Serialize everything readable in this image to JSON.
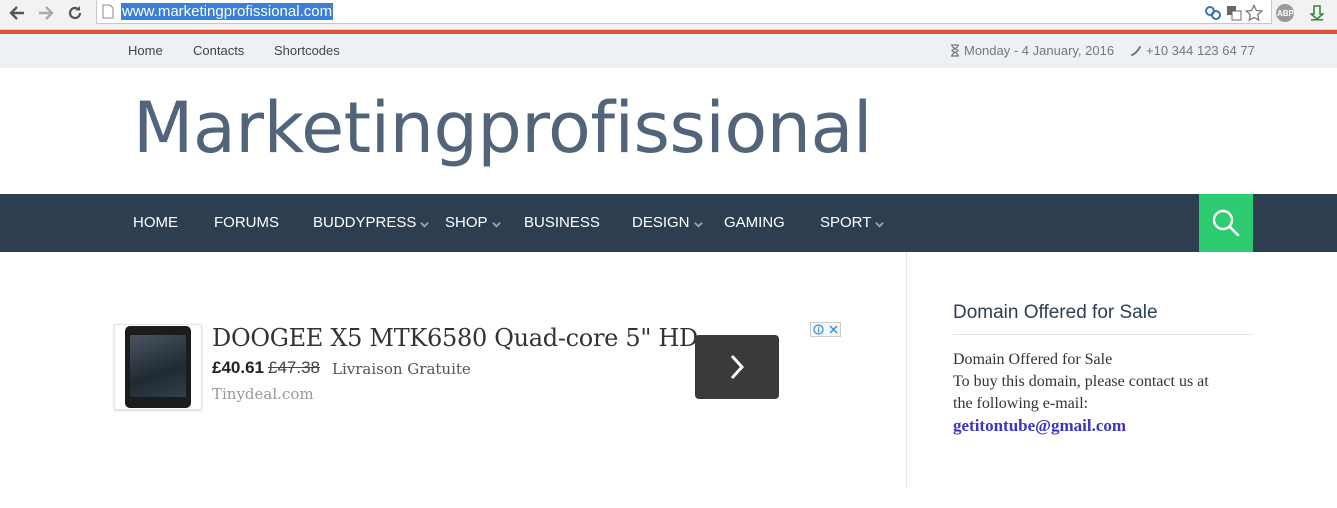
{
  "browser": {
    "url": "www.marketingprofissional.com",
    "abp_label": "ABP"
  },
  "topbar": {
    "links": [
      "Home",
      "Contacts",
      "Shortcodes"
    ],
    "date": "Monday - 4 January, 2016",
    "phone": "+10 344 123 64 77"
  },
  "header": {
    "site_title": "Marketingprofissional"
  },
  "nav": {
    "items": [
      {
        "label": "HOME"
      },
      {
        "label": "FORUMS"
      },
      {
        "label": "BUDDYPRESS"
      },
      {
        "label": "SHOP"
      },
      {
        "label": "BUSINESS"
      },
      {
        "label": "DESIGN"
      },
      {
        "label": "GAMING"
      },
      {
        "label": "SPORT"
      }
    ]
  },
  "ad": {
    "title": "DOOGEE X5 MTK6580 Quad-core 5\" HD...",
    "price": "£40.61",
    "old_price": "£47.38",
    "shipping": "Livraison Gratuite",
    "source": "Tinydeal.com"
  },
  "sidebar": {
    "title": "Domain Offered for Sale",
    "line1": "Domain Offered for Sale",
    "line2": "To buy this domain, please contact us at",
    "line3": "the following e-mail:",
    "email": "getitontube@gmail.com"
  },
  "colors": {
    "accent": "#e1523d",
    "nav_bg": "#2c3e50",
    "search_bg": "#2ecc71",
    "title": "#526479"
  }
}
